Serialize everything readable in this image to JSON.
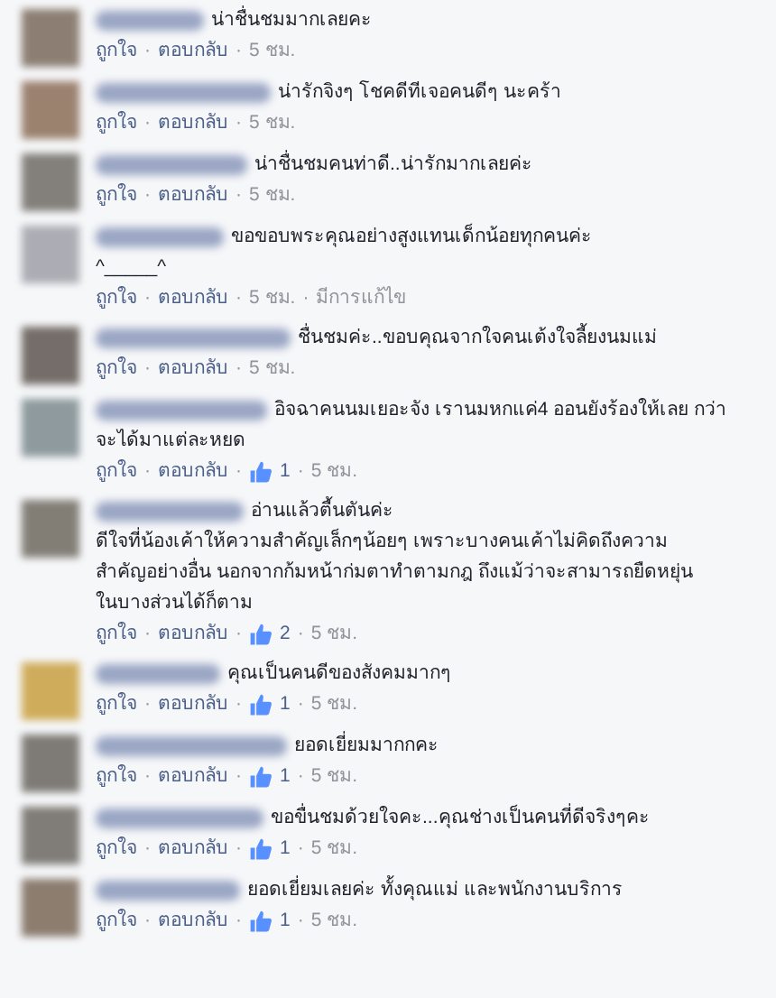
{
  "separator": "·",
  "comments": [
    {
      "lines": [
        "น่าชื่นชมมากเลยคะ"
      ],
      "actions": [
        "ถูกใจ",
        "ตอบกลับ"
      ],
      "time": "5 ชม."
    },
    {
      "lines": [
        "น่ารักจิงๆ โชคดีทีเจอคนดีๆ นะคร้า"
      ],
      "actions": [
        "ถูกใจ",
        "ตอบกลับ"
      ],
      "time": "5 ชม."
    },
    {
      "lines": [
        "น่าชื่นชมคนท่าดี..น่ารักมากเลยค่ะ"
      ],
      "actions": [
        "ถูกใจ",
        "ตอบกลับ"
      ],
      "time": "5 ชม."
    },
    {
      "lines": [
        "ขอขอบพระคุณอย่างสูงแทนเด็กน้อยทุกคนค่ะ",
        "^_____^"
      ],
      "actions": [
        "ถูกใจ",
        "ตอบกลับ"
      ],
      "time": "5 ชม.",
      "edited": "มีการแก้ไข"
    },
    {
      "lines": [
        "ชื่นชมค่ะ..ขอบคุณจากใจคนเต้งใจลี้ยงนมแม่"
      ],
      "actions": [
        "ถูกใจ",
        "ตอบกลับ"
      ],
      "time": "5 ชม."
    },
    {
      "lines": [
        "อิจฉาคนนมเยอะจัง เรานมหกแค่4 ออนยังร้องให้เลย กว่า",
        "จะได้มาแต่ละหยด"
      ],
      "actions": [
        "ถูกใจ",
        "ตอบกลับ"
      ],
      "likes": "1",
      "time": "5 ชม."
    },
    {
      "lines": [
        "อ่านแล้วตื้นตันค่ะ",
        "ดีใจที่น้องเค้าให้ความสำคัญเล็กๆน้อยๆ เพราะบางคนเค้าไม่คิดถึงความ",
        "สำคัญอย่างอื่น นอกจากก้มหน้าก่มตาทำตามกฎ ถึงแม้ว่าจะสามารถยืดหยุ่น",
        "ในบางส่วนได้ก็ตาม"
      ],
      "actions": [
        "ถูกใจ",
        "ตอบกลับ"
      ],
      "likes": "2",
      "time": "5 ชม."
    },
    {
      "lines": [
        "คุณเป็นคนดีของสังคมมากๆ"
      ],
      "actions": [
        "ถูกใจ",
        "ตอบกลับ"
      ],
      "likes": "1",
      "time": "5 ชม."
    },
    {
      "lines": [
        "ยอดเยี่ยมมากกคะ"
      ],
      "actions": [
        "ถูกใจ",
        "ตอบกลับ"
      ],
      "likes": "1",
      "time": "5 ชม."
    },
    {
      "lines": [
        "ขอขื่นชมด้วยใจคะ...คุณช่างเป็นคนที่ดีจริงๆคะ"
      ],
      "actions": [
        "ถูกใจ",
        "ตอบกลับ"
      ],
      "likes": "1",
      "time": "5 ชม."
    },
    {
      "lines": [
        "ยอดเยี่ยมเลยค่ะ ทั้งคุณแม่ และพนักงานบริการ"
      ],
      "actions": [
        "ถูกใจ",
        "ตอบกลับ"
      ],
      "likes": "1",
      "time": "5 ชม."
    }
  ]
}
